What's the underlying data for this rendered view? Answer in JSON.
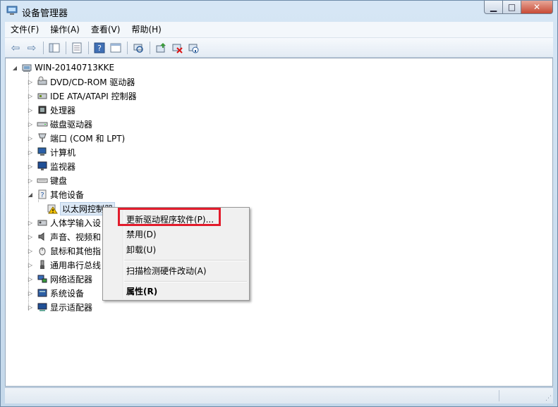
{
  "window": {
    "title": "设备管理器"
  },
  "menubar": {
    "items": [
      "文件(F)",
      "操作(A)",
      "查看(V)",
      "帮助(H)"
    ]
  },
  "tree": {
    "root": "WIN-20140713KKE",
    "categories": [
      {
        "label": "DVD/CD-ROM 驱动器",
        "icon": "dvd-drive-icon",
        "expanded": false
      },
      {
        "label": "IDE ATA/ATAPI 控制器",
        "icon": "ide-controller-icon",
        "expanded": false
      },
      {
        "label": "处理器",
        "icon": "processor-icon",
        "expanded": false
      },
      {
        "label": "磁盘驱动器",
        "icon": "disk-drive-icon",
        "expanded": false
      },
      {
        "label": "端口 (COM 和 LPT)",
        "icon": "port-icon",
        "expanded": false
      },
      {
        "label": "计算机",
        "icon": "computer-icon",
        "expanded": false
      },
      {
        "label": "监视器",
        "icon": "monitor-icon",
        "expanded": false
      },
      {
        "label": "键盘",
        "icon": "keyboard-icon",
        "expanded": false
      },
      {
        "label": "其他设备",
        "icon": "unknown-device-icon",
        "expanded": true
      },
      {
        "label": "人体学输入设",
        "icon": "hid-icon",
        "expanded": false
      },
      {
        "label": "声音、视频和",
        "icon": "sound-icon",
        "expanded": false
      },
      {
        "label": "鼠标和其他指",
        "icon": "mouse-icon",
        "expanded": false
      },
      {
        "label": "通用串行总线",
        "icon": "usb-icon",
        "expanded": false
      },
      {
        "label": "网络适配器",
        "icon": "network-adapter-icon",
        "expanded": false
      },
      {
        "label": "系统设备",
        "icon": "system-device-icon",
        "expanded": false
      },
      {
        "label": "显示适配器",
        "icon": "display-adapter-icon",
        "expanded": false
      }
    ],
    "child_of_other": "以太网控制器"
  },
  "context_menu": {
    "items": [
      "更新驱动程序软件(P)...",
      "禁用(D)",
      "卸载(U)",
      "扫描检测硬件改动(A)",
      "属性(R)"
    ]
  },
  "colors": {
    "highlight": "#e21c2c",
    "selection": "#dbe8f6"
  }
}
